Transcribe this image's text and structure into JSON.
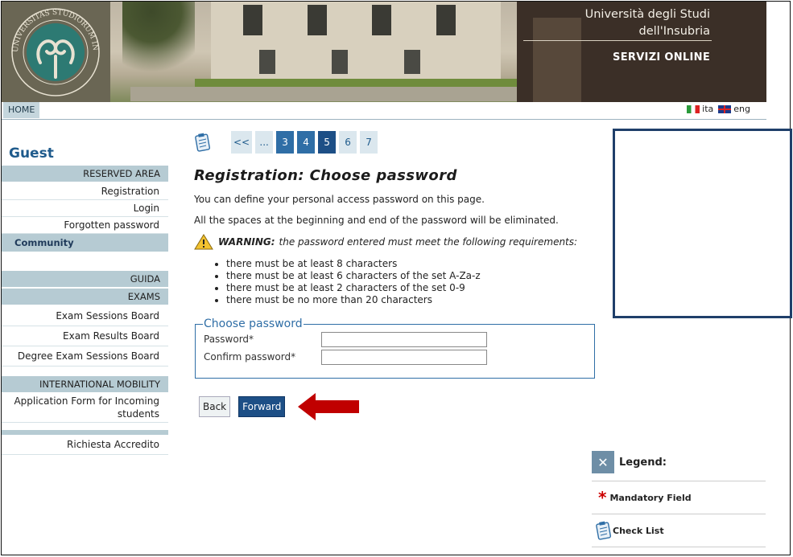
{
  "header": {
    "university_line1": "Università degli Studi",
    "university_line2": "dell'Insubria",
    "servizi": "SERVIZI ONLINE",
    "logo_text": "UNIVERSITAS STUDIORUM INSUBRIAE"
  },
  "navbar": {
    "home": "HOME",
    "lang_it": "ita",
    "lang_en": "eng"
  },
  "sidebar": {
    "user": "Guest",
    "reserved_area": "RESERVED AREA",
    "registration": "Registration",
    "login": "Login",
    "forgotten_password": "Forgotten password",
    "community": "Community",
    "guida": "GUIDA",
    "exams": "EXAMS",
    "exam_sessions_board": "Exam Sessions Board",
    "exam_results_board": "Exam Results Board",
    "degree_exam_sessions_board": "Degree Exam Sessions Board",
    "international_mobility": "INTERNATIONAL MOBILITY",
    "application_form_line1": "Application Form for Incoming",
    "application_form_line2": "students",
    "richiesta_accredito": "Richiesta Accredito"
  },
  "pager": {
    "first": "<<",
    "ellipsis": "...",
    "p3": "3",
    "p4": "4",
    "p5": "5",
    "p6": "6",
    "p7": "7",
    "current": 5
  },
  "main": {
    "title": "Registration: Choose password",
    "intro1": "You can define your personal access password on this page.",
    "intro2": "All the spaces at the beginning and end of the password will be eliminated.",
    "warning_label": "WARNING:",
    "warning_text": "the password entered must meet the following requirements:",
    "requirements": [
      "there must be at least 8 characters",
      "there must be at least 6 characters of the set A-Za-z",
      "there must be at least 2 characters of the set 0-9",
      "there must be no more than 20 characters"
    ],
    "fieldset_legend": "Choose password",
    "password_label": "Password*",
    "confirm_label": "Confirm password*",
    "password_value": "",
    "confirm_value": "",
    "back_button": "Back",
    "forward_button": "Forward"
  },
  "legend": {
    "title": "Legend:",
    "mandatory": "Mandatory Field",
    "checklist": "Check List"
  },
  "colors": {
    "accent": "#1d4f86",
    "sidebar_section": "#b6cbd3",
    "arrow": "#c00000"
  }
}
